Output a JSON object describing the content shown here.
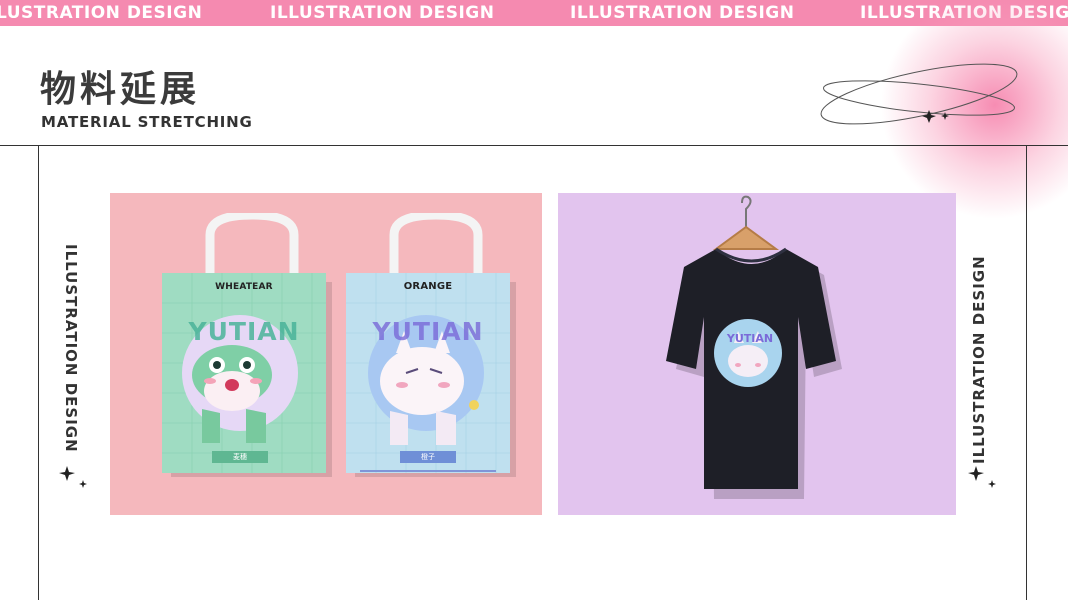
{
  "banner": {
    "items": [
      "LUSTRATION DESIGN",
      "ILLUSTRATION DESIGN",
      "ILLUSTRATION DESIGN",
      "ILLUSTRATION DESIGN"
    ]
  },
  "header": {
    "title_cn": "物料延展",
    "title_en": "MATERIAL STRETCHING"
  },
  "side": {
    "left": "ILLUSTRATION DESIGN",
    "right": "ILLUSTRATION DESIGN"
  },
  "mockups": {
    "bag_green": {
      "tag": "WHEATEAR",
      "word": "YUTIAN",
      "foot": "麦穗"
    },
    "bag_blue": {
      "tag": "ORANGE",
      "word": "YUTIAN",
      "foot": "橙子"
    },
    "tshirt": {
      "word": "YUTIAN"
    }
  },
  "colors": {
    "banner": "#f58ab0",
    "panel_pink": "#f5b8bd",
    "panel_lavender": "#e2c4ee",
    "bag_green": "#9fdcc2",
    "bag_blue": "#bfe0ef",
    "tshirt": "#1e1f27"
  }
}
